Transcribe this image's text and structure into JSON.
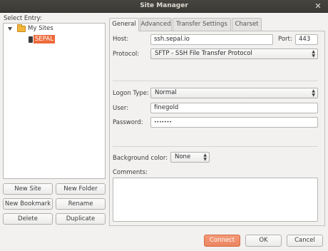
{
  "window": {
    "title": "Site Manager"
  },
  "tree": {
    "heading": "Select Entry:",
    "folder_label": "My Sites",
    "site_label": "SEPAL"
  },
  "left_buttons": {
    "new_site": "New Site",
    "new_folder": "New Folder",
    "new_bookmark": "New Bookmark",
    "rename": "Rename",
    "delete": "Delete",
    "duplicate": "Duplicate"
  },
  "tabs": [
    "General",
    "Advanced",
    "Transfer Settings",
    "Charset"
  ],
  "general": {
    "host_label": "Host:",
    "host_value": "ssh.sepal.io",
    "port_label": "Port:",
    "port_value": "443",
    "protocol_label": "Protocol:",
    "protocol_value": "SFTP - SSH File Transfer Protocol",
    "logon_label": "Logon Type:",
    "logon_value": "Normal",
    "user_label": "User:",
    "user_value": "finegold",
    "password_label": "Password:",
    "password_value": "•••••••",
    "bgcolor_label": "Background color:",
    "bgcolor_value": "None",
    "comments_label": "Comments:"
  },
  "footer": {
    "connect": "Connect",
    "ok": "OK",
    "cancel": "Cancel"
  },
  "colors": {
    "accent": "#ee6a3a",
    "titlebar": "#3c3b37"
  }
}
